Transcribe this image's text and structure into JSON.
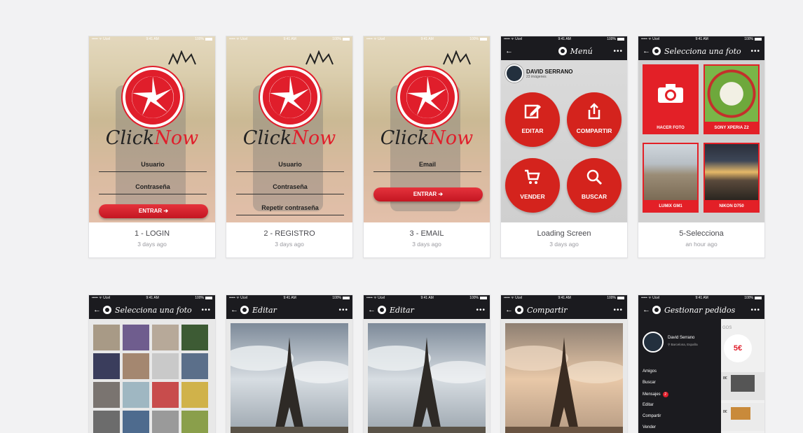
{
  "cards_row1": [
    {
      "title": "1 - LOGIN",
      "time": "3 days ago"
    },
    {
      "title": "2 - REGISTRO",
      "time": "3 days ago"
    },
    {
      "title": "3 - EMAIL",
      "time": "3 days ago"
    },
    {
      "title": "Loading Screen",
      "time": "3 days ago"
    },
    {
      "title": "5-Selecciona",
      "time": "an hour ago"
    }
  ],
  "status": {
    "carrier": "••••• ᯤ Ucel",
    "time": "9:41 AM",
    "battery": "100%"
  },
  "brand": {
    "click": "Click",
    "now": "Now"
  },
  "login": {
    "user": "Usuario",
    "pass": "Contraseña",
    "enter": "ENTRAR ➔"
  },
  "registro": {
    "user": "Usuario",
    "pass": "Contraseña",
    "repeat": "Repetir contraseña"
  },
  "email": {
    "email": "Email",
    "enter": "ENTRAR ➔"
  },
  "menu": {
    "title": "Menú",
    "user": "DAVID SERRANO",
    "sub": "23 imágenes",
    "buttons": [
      "EDITAR",
      "COMPARTIR",
      "VENDER",
      "BUSCAR"
    ]
  },
  "select": {
    "title": "Selecciona una foto",
    "tiles": [
      "HACER FOTO",
      "SONY XPERIA Z2",
      "LUMIX GM1",
      "NIKON D750"
    ]
  },
  "row2_titles": [
    "Selecciona una foto",
    "Editar",
    "Editar",
    "Compartir",
    "Gestionar pedidos"
  ],
  "orders": {
    "name": "David Serrano",
    "location": "⚲ Barcelona, España",
    "items": [
      "Amigos",
      "Buscar",
      "Mensajes",
      "Editar",
      "Compartir",
      "Vender"
    ],
    "badge": "2",
    "peek_label": "GOS",
    "peek_price": "5€",
    "peek_row1": "8€",
    "peek_row2": "8€"
  },
  "colors": {
    "accent": "#e01e2b",
    "appbar": "#1b1b1f"
  }
}
